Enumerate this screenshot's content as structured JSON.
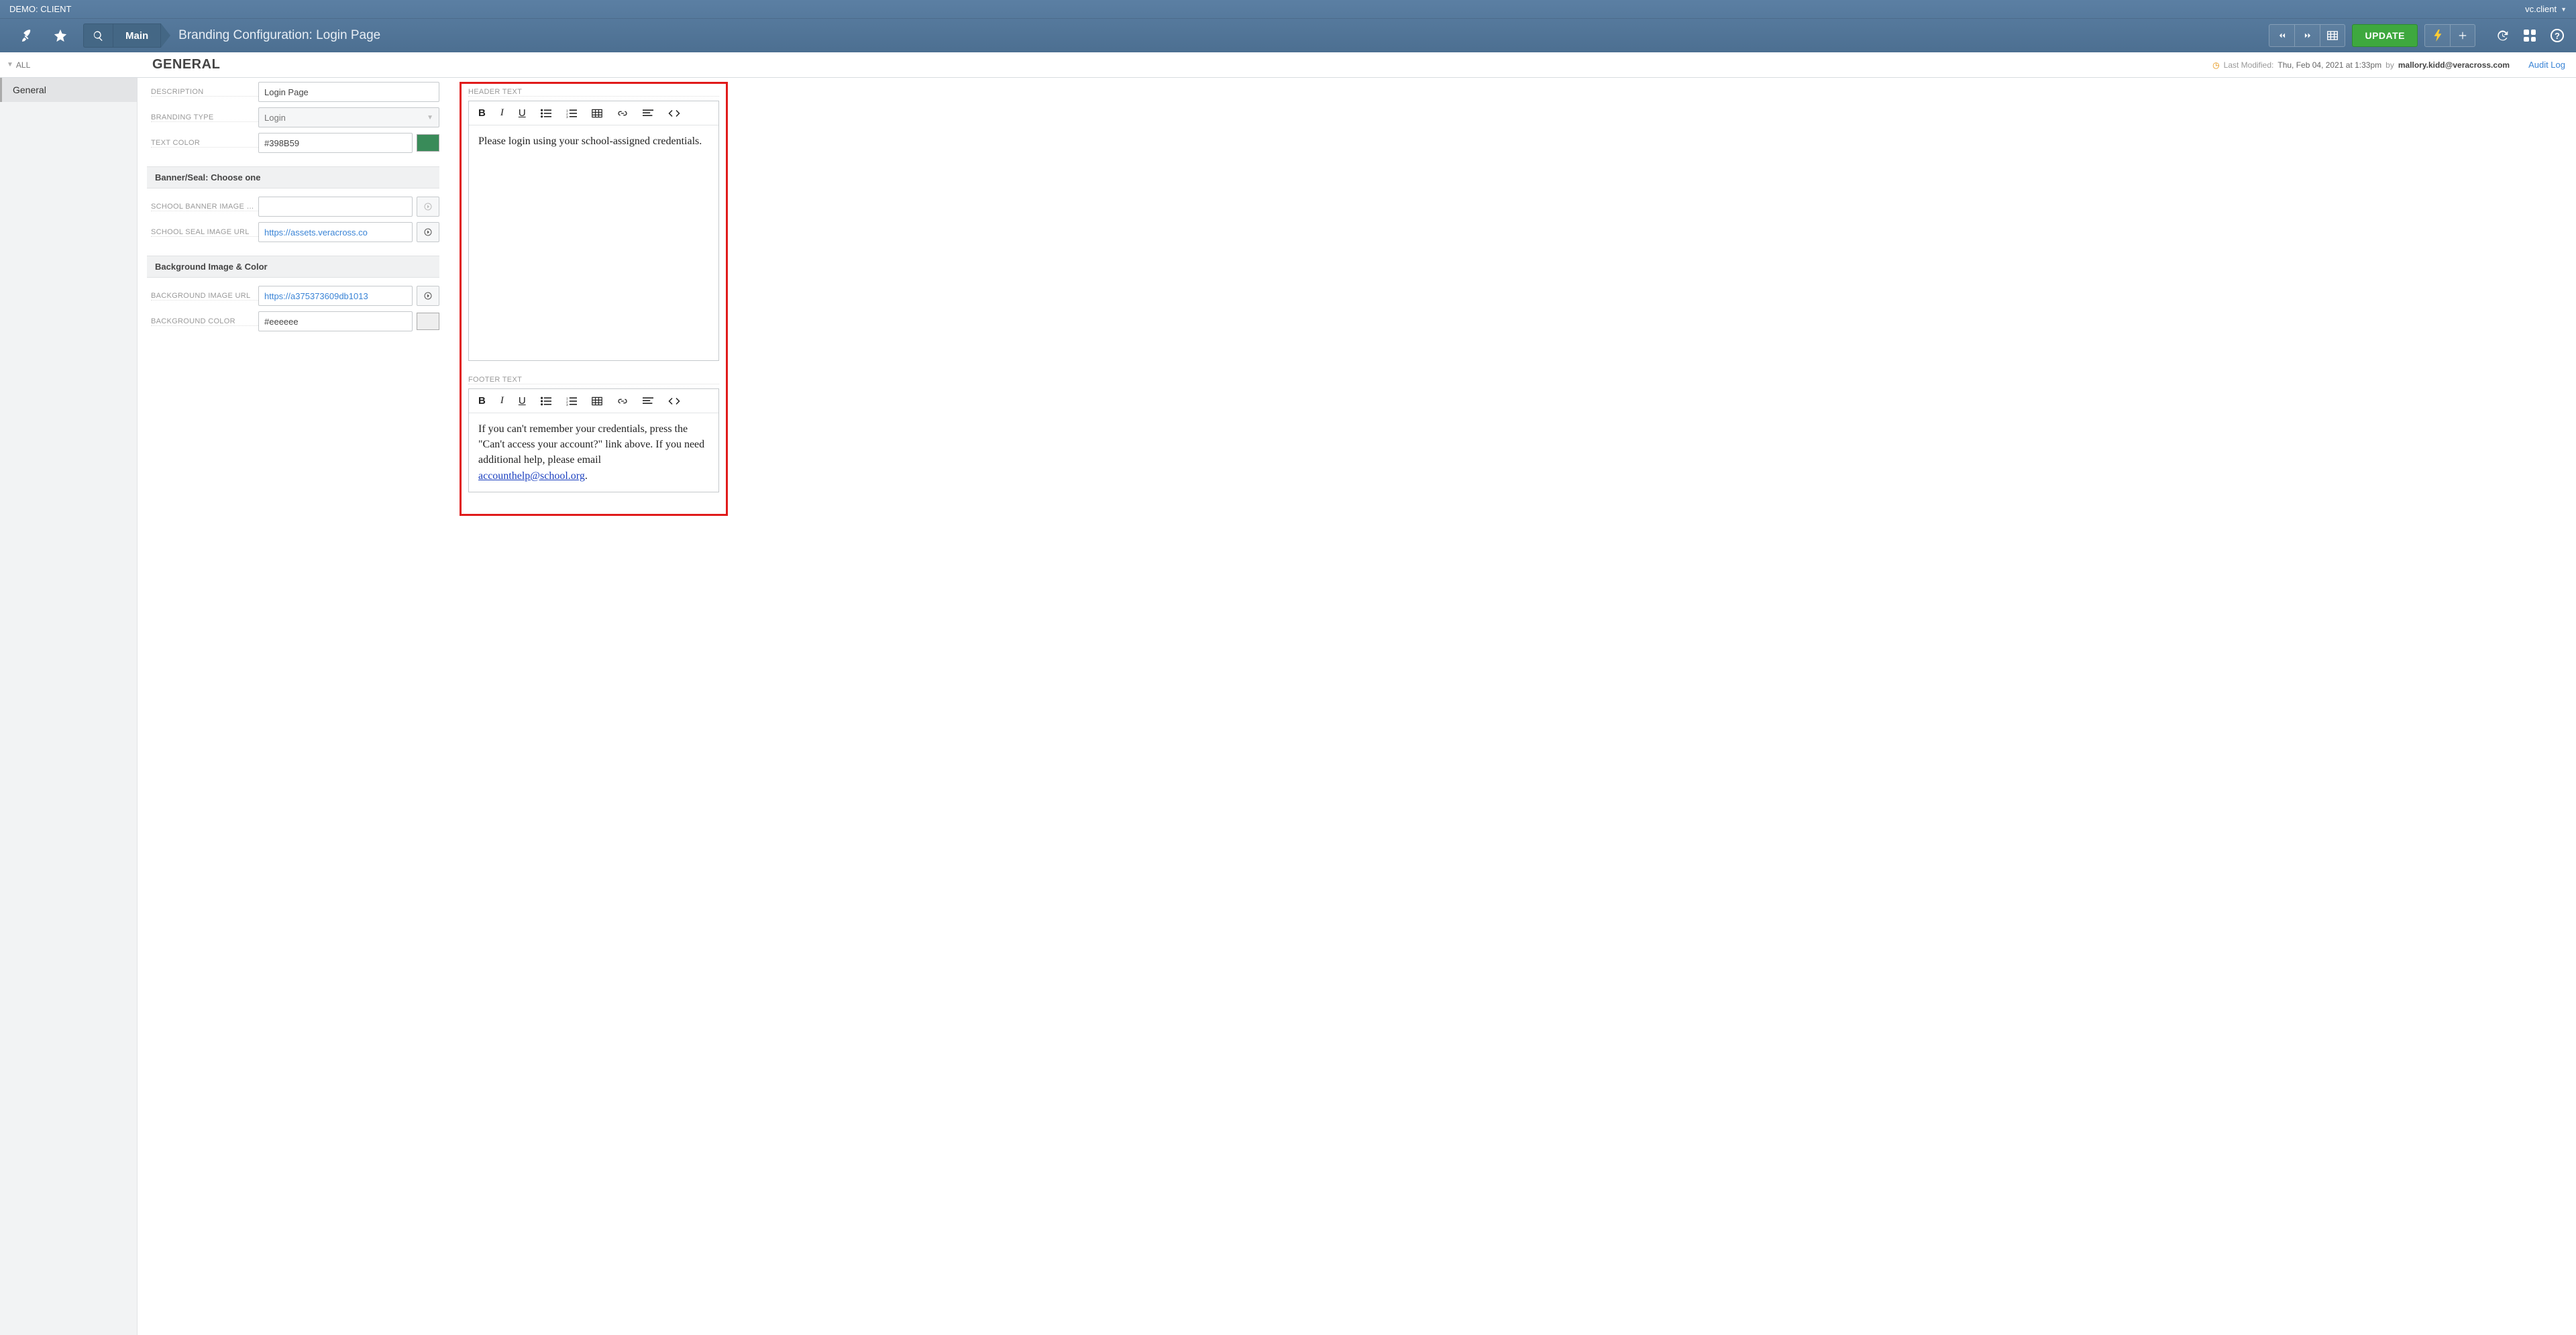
{
  "topbar": {
    "client_label": "DEMO: CLIENT",
    "user_label": "vc.client"
  },
  "nav": {
    "main_tab": "Main",
    "page_title": "Branding Configuration: Login Page",
    "update_label": "UPDATE"
  },
  "meta": {
    "sidebar_all": "ALL",
    "heading": "GENERAL",
    "last_modified_label": "Last Modified:",
    "stamp_date": "Thu, Feb 04, 2021 at 1:33pm",
    "stamp_by": "by",
    "stamp_user": "mallory.kidd@veracross.com",
    "audit_log": "Audit Log"
  },
  "sidebar": {
    "items": [
      {
        "label": "General",
        "active": true
      }
    ]
  },
  "form": {
    "description": {
      "label": "DESCRIPTION",
      "value": "Login Page"
    },
    "branding_type": {
      "label": "BRANDING TYPE",
      "value": "Login"
    },
    "text_color": {
      "label": "TEXT COLOR",
      "value": "#398B59",
      "swatch": "#398B59"
    },
    "section_banner": "Banner/Seal: Choose one",
    "school_banner": {
      "label": "SCHOOL BANNER IMAGE …",
      "value": ""
    },
    "school_seal": {
      "label": "SCHOOL SEAL IMAGE URL",
      "value": "https://assets.veracross.co"
    },
    "section_bg": "Background Image & Color",
    "bg_image": {
      "label": "BACKGROUND IMAGE URL",
      "value": "https://a375373609db1013"
    },
    "bg_color": {
      "label": "BACKGROUND COLOR",
      "value": "#eeeeee",
      "swatch": "#eeeeee"
    }
  },
  "editors": {
    "header": {
      "label": "HEADER TEXT",
      "body": "Please login using your school-assigned credentials."
    },
    "footer": {
      "label": "FOOTER TEXT",
      "body_prefix": "If you can't remember your credentials, press the \"Can't access your account?\" link above. If you need additional help, please email ",
      "body_link": "accounthelp@school.org",
      "body_suffix": "."
    },
    "tools": {
      "bold": "B",
      "italic": "I",
      "underline": "U"
    }
  }
}
